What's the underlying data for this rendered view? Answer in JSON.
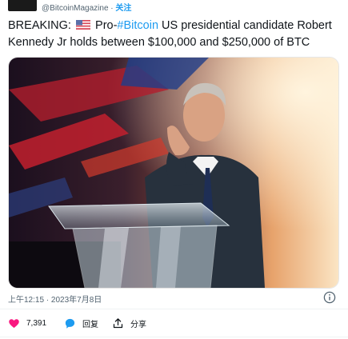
{
  "tweet": {
    "handle": "@BitcoinMagazine",
    "separator": " · ",
    "follow_label": "关注",
    "text_before_flag": "BREAKING: ",
    "text_after_flag": " Pro-",
    "hashtag": "#Bitcoin",
    "text_rest": " US presidential candidate Robert Kennedy Jr holds between $100,000 and $250,000 of BTC",
    "timestamp": "上午12:15 · 2023年7月8日"
  },
  "actions": {
    "likes_count": "7,391",
    "reply_label": "回复",
    "share_label": "分享"
  },
  "icons": [
    "flag-us-icon",
    "info-icon",
    "heart-icon",
    "reply-icon",
    "share-icon"
  ],
  "colors": {
    "link": "#1d9bf0",
    "like": "#f91880",
    "reply": "#1d9bf0",
    "muted": "#536471"
  }
}
